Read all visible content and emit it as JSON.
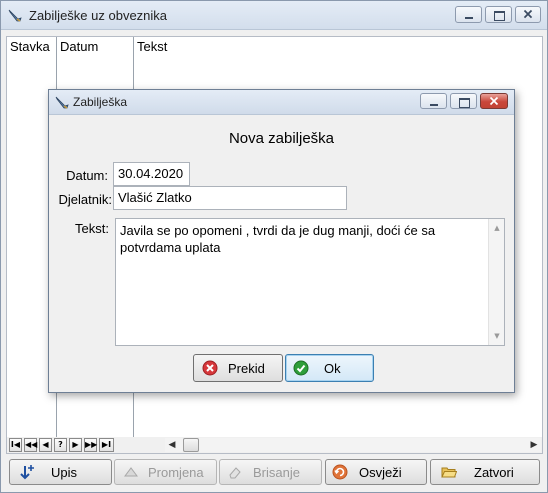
{
  "window": {
    "title": "Zabilješke uz obveznika"
  },
  "grid": {
    "columns": [
      "Stavka",
      "Datum",
      "Tekst"
    ]
  },
  "navigator": {
    "buttons": [
      "I◀",
      "◀◀",
      "◀",
      "?",
      "▶",
      "▶▶",
      "▶I"
    ]
  },
  "toolbar": {
    "upis": "Upis",
    "promjena": "Promjena",
    "brisanje": "Brisanje",
    "osvjezi": "Osvježi",
    "zatvori": "Zatvori"
  },
  "dialog": {
    "title": "Zabilješka",
    "heading": "Nova zabilješka",
    "datum_label": "Datum:",
    "datum_value": "30.04.2020",
    "djelatnik_label": "Djelatnik:",
    "djelatnik_value": "Vlašić Zlatko",
    "tekst_label": "Tekst:",
    "tekst_value": "Javila se po opomeni , tvrdi da je dug manji, doći će sa\npotvrdama uplata",
    "cancel_label": "Prekid",
    "ok_label": "Ok"
  },
  "colors": {
    "accent": "#3c7fb1",
    "close_red": "#c24335",
    "ok_green": "#2e9e3a"
  }
}
